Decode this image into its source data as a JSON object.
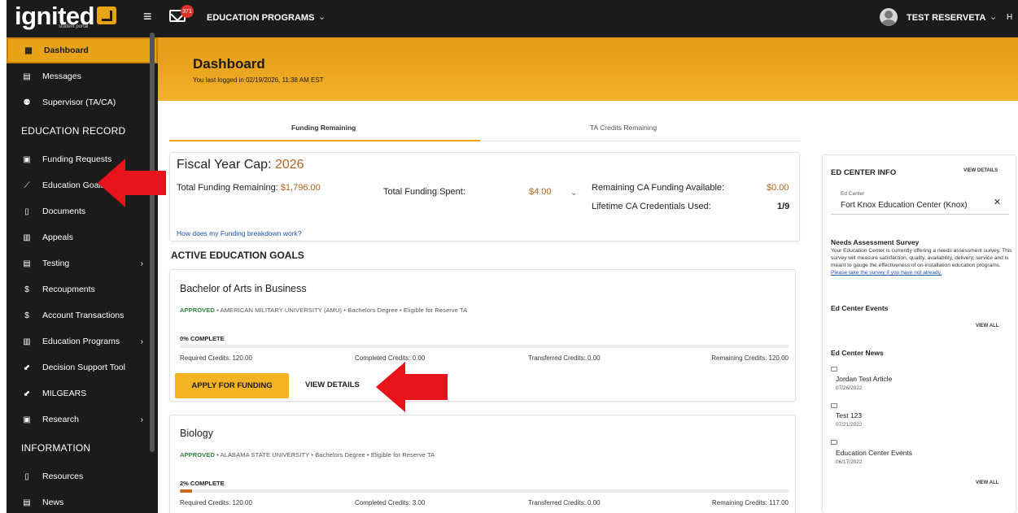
{
  "sidebar": {
    "logo": "ignited",
    "logo_sub": "student portal",
    "items": [
      {
        "label": "Dashboard",
        "icon": "grid-icon",
        "glyph": "▦"
      },
      {
        "label": "Messages",
        "icon": "message-icon",
        "glyph": "▤"
      },
      {
        "label": "Supervisor (TA/CA)",
        "icon": "users-icon",
        "glyph": "⚉"
      }
    ],
    "section_education": "EDUCATION RECORD",
    "education_items": [
      {
        "label": "Funding Requests",
        "icon": "funding-icon",
        "glyph": "▣"
      },
      {
        "label": "Education Goals",
        "icon": "trend-icon",
        "glyph": "⟋"
      },
      {
        "label": "Documents",
        "icon": "document-icon",
        "glyph": "▯"
      },
      {
        "label": "Appeals",
        "icon": "appeals-icon",
        "glyph": "▥"
      },
      {
        "label": "Testing",
        "icon": "testing-icon",
        "glyph": "▤"
      },
      {
        "label": "Recoupments",
        "icon": "dollar-icon",
        "glyph": "$"
      },
      {
        "label": "Account Transactions",
        "icon": "dollar-icon",
        "glyph": "$"
      },
      {
        "label": "Education Programs",
        "icon": "programs-icon",
        "glyph": "▥"
      },
      {
        "label": "Decision Support Tool",
        "icon": "compass-icon",
        "glyph": "⬋"
      },
      {
        "label": "MILGEARS",
        "icon": "compass-icon",
        "glyph": "⬋"
      },
      {
        "label": "Research",
        "icon": "research-icon",
        "glyph": "▣"
      }
    ],
    "section_information": "INFORMATION",
    "info_items": [
      {
        "label": "Resources",
        "icon": "document-icon",
        "glyph": "▯"
      },
      {
        "label": "News",
        "icon": "news-icon",
        "glyph": "▤"
      }
    ],
    "chevron": "›"
  },
  "topbar": {
    "badge_count": "371",
    "title": "EDUCATION PROGRAMS",
    "chevron": "⌄",
    "user_name": "TEST RESERVETA",
    "extra": "H"
  },
  "banner": {
    "title": "Dashboard",
    "subtitle": "You last logged in 02/19/2026, 11:38 AM EST"
  },
  "tabs": {
    "funding": "Funding Remaining",
    "ta": "TA Credits Remaining"
  },
  "funding": {
    "cap_label": "Fiscal Year Cap:",
    "cap_year": "2026",
    "remaining_label": "Total Funding Remaining:",
    "remaining_value": "$1,796.00",
    "spent_label": "Total Funding Spent:",
    "spent_value": "$4.00",
    "ca_label": "Remaining CA Funding Available:",
    "ca_value": "$0.00",
    "credentials_label": "Lifetime CA Credentials Used:",
    "credentials_value": "1/9",
    "how_link": "How does my Funding breakdown work?"
  },
  "goals": {
    "section_title": "ACTIVE EDUCATION GOALS",
    "items": [
      {
        "name": "Bachelor of Arts in Business",
        "status": "APPROVED",
        "meta": " • AMERICAN MILITARY UNIVERSITY (AMU) • Bachelors Degree • Eligible for Reserve TA",
        "complete_label": "0% COMPLETE",
        "progress": 0,
        "required": "Required Credits: 120.00",
        "completed": "Completed Credits: 0.00",
        "transferred": "Transferred Credits: 0.00",
        "remaining": "Remaining Credits: 120.00",
        "apply_label": "APPLY FOR FUNDING",
        "view_label": "VIEW DETAILS"
      },
      {
        "name": "Biology",
        "status": "APPROVED",
        "meta": " • ALABAMA STATE UNIVERSITY • Bachelors Degree • Eligible for Reserve TA",
        "complete_label": "2% COMPLETE",
        "progress": 2,
        "required": "Required Credits: 120.00",
        "completed": "Completed Credits: 3.00",
        "transferred": "Transferred Credits: 0.00",
        "remaining": "Remaining Credits: 117.00"
      }
    ]
  },
  "ed_center": {
    "title": "ED CENTER INFO",
    "view_details": "VIEW DETAILS",
    "select_label": "Ed Center",
    "select_value": "Fort Knox Education Center (Knox)",
    "close": "×",
    "survey_title": "Needs Assessment Survey",
    "survey_text": "Your Education Center is currently offering a needs assessment survey. This survey will measure satisfaction, quality, availability, delivery, service and is meant to gauge the effectiveness of on-installation education programs. ",
    "survey_link": "Please take the survey if you have not already.",
    "events_title": "Ed Center Events",
    "view_all": "VIEW ALL",
    "news_title": "Ed Center News",
    "news": [
      {
        "title": "Jordan Test Article",
        "date": "07/26/2022"
      },
      {
        "title": "Test 123",
        "date": "07/21/2022"
      },
      {
        "title": "Education Center Events",
        "date": "06/17/2022"
      }
    ]
  },
  "colors": {
    "accent": "#e8a317",
    "sidebar_bg": "#1b1b1b",
    "approved": "#2e8540",
    "money": "#b5631c",
    "annotation_arrow": "#e8141b"
  }
}
